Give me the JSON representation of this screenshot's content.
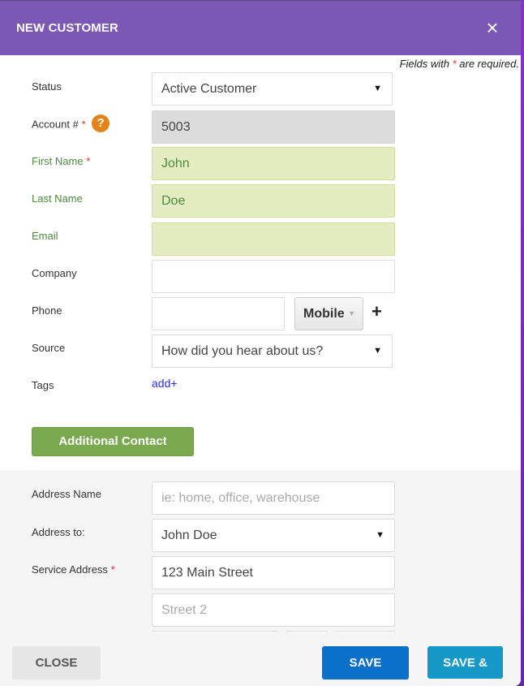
{
  "header": {
    "title": "NEW CUSTOMER",
    "close_icon": "×"
  },
  "required_note": {
    "prefix": "Fields with ",
    "star": "*",
    "suffix": " are required."
  },
  "fields": {
    "status": {
      "label": "Status",
      "value": "Active Customer",
      "caret": "▼"
    },
    "account": {
      "label": "Account #",
      "star": "*",
      "help": "?",
      "value": "5003"
    },
    "first_name": {
      "label": "First Name",
      "star": "*",
      "value": "John"
    },
    "last_name": {
      "label": "Last Name",
      "value": "Doe"
    },
    "email": {
      "label": "Email",
      "value": ""
    },
    "company": {
      "label": "Company",
      "value": ""
    },
    "phone": {
      "label": "Phone",
      "value": "",
      "type": "Mobile",
      "type_caret": "▼",
      "add": "+"
    },
    "source": {
      "label": "Source",
      "value": "How did you hear about us?",
      "caret": "▼"
    },
    "tags": {
      "label": "Tags",
      "add_link": "add+"
    }
  },
  "additional_contact_label": "Additional Contact",
  "address": {
    "address_name": {
      "label": "Address Name",
      "placeholder": "ie: home, office, warehouse"
    },
    "address_to": {
      "label": "Address to:",
      "value": "John Doe",
      "caret": "▼"
    },
    "service_address": {
      "label": "Service Address",
      "star": "*",
      "value": "123 Main Street"
    },
    "street2": {
      "placeholder": "Street 2"
    }
  },
  "footer": {
    "close_label": "CLOSE",
    "save_label": "SAVE",
    "save_and_label": "SAVE &"
  },
  "colors": {
    "header": "#7b57b6",
    "valid_field": "#e3edc1",
    "valid_text": "#4f8a3f",
    "additional_contact": "#7aa94f",
    "save": "#0b70c9",
    "save_and": "#1698c9",
    "help_icon": "#e38318",
    "required_star": "#e52b2b",
    "link": "#2a33d6"
  }
}
